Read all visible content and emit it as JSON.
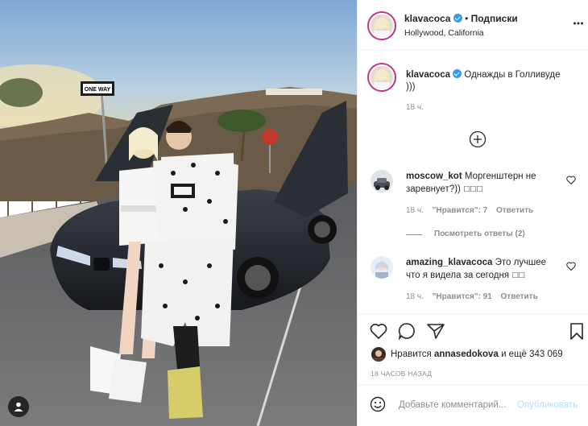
{
  "post": {
    "username": "klavacoca",
    "dot": "•",
    "follow_label": "Подписки",
    "location": "Hollywood, California",
    "more_icon": "more-horizontal-icon",
    "caption_text": "Однажды в Голливуде",
    "caption_text2": ")))",
    "caption_time": "18 ч.",
    "street_sign": "ONE WAY"
  },
  "comments": [
    {
      "username": "moscow_kot",
      "text": "Моргенштерн не",
      "text2": "заревнует?))",
      "time": "18 ч.",
      "likes": "\"Нравится\": 7",
      "reply": "Ответить",
      "view_replies": "Посмотреть ответы (2)"
    },
    {
      "username": "amazing_klavacoca",
      "text": "Это лучшее",
      "text2": "что я видела за сегодня",
      "time": "18 ч.",
      "likes": "\"Нравится\": 91",
      "reply": "Ответить"
    }
  ],
  "actions": {
    "liked_by_prefix": "Нравится",
    "liked_by_user": "annasedokova",
    "liked_by_suffix": "и ещё 343 069",
    "timestamp": "18 ЧАСОВ НАЗАД"
  },
  "composer": {
    "placeholder": "Добавьте комментарий...",
    "publish_label": "Опубликовать"
  },
  "colors": {
    "verified": "#3897f0",
    "ring": "#c13584",
    "publish": "#b2dffc"
  }
}
